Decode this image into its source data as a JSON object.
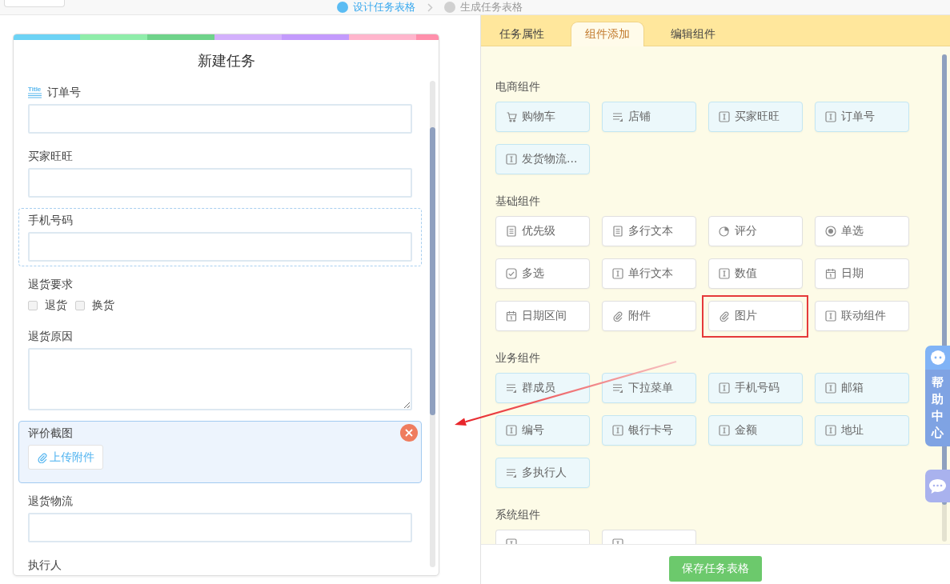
{
  "top_bar": {
    "steps": [
      {
        "label": "设计任务表格",
        "active": true
      },
      {
        "label": "生成任务表格",
        "active": false
      }
    ]
  },
  "form": {
    "title": "新建任务",
    "fields": [
      {
        "label": "订单号",
        "badge": "Title",
        "kind": "input",
        "hovered": false,
        "selected": false
      },
      {
        "label": "买家旺旺",
        "kind": "input",
        "hovered": false,
        "selected": false
      },
      {
        "label": "手机号码",
        "kind": "input",
        "hovered": true,
        "selected": false
      },
      {
        "label": "退货要求",
        "kind": "checkboxes",
        "hovered": false,
        "selected": false,
        "options": [
          {
            "label": "退货",
            "checked": false
          },
          {
            "label": "换货",
            "checked": false
          }
        ]
      },
      {
        "label": "退货原因",
        "kind": "textarea",
        "hovered": false,
        "selected": false
      },
      {
        "label": "评价截图",
        "kind": "upload",
        "button": "上传附件",
        "hovered": false,
        "selected": true
      },
      {
        "label": "退货物流",
        "kind": "input",
        "hovered": false,
        "selected": false
      },
      {
        "label": "执行人",
        "kind": "label",
        "hovered": false,
        "selected": false
      }
    ]
  },
  "panel": {
    "tabs": [
      {
        "label": "任务属性",
        "selected": false
      },
      {
        "label": "组件添加",
        "selected": true
      },
      {
        "label": "编辑组件",
        "selected": false
      }
    ],
    "sections": [
      {
        "title": "电商组件",
        "tinted": true,
        "clipped": false,
        "items": [
          {
            "label": "购物车",
            "kind": "cart",
            "highlighted": false
          },
          {
            "label": "店铺",
            "kind": "list",
            "highlighted": false
          },
          {
            "label": "买家旺旺",
            "kind": "input",
            "highlighted": false
          },
          {
            "label": "订单号",
            "kind": "input",
            "highlighted": false
          },
          {
            "label": "发货物流...",
            "kind": "input",
            "highlighted": false
          }
        ]
      },
      {
        "title": "基础组件",
        "tinted": false,
        "clipped": false,
        "items": [
          {
            "label": "优先级",
            "kind": "doc",
            "highlighted": false
          },
          {
            "label": "多行文本",
            "kind": "doc",
            "highlighted": false
          },
          {
            "label": "评分",
            "kind": "pie",
            "highlighted": false
          },
          {
            "label": "单选",
            "kind": "radio",
            "highlighted": false
          },
          {
            "label": "多选",
            "kind": "checkbox",
            "highlighted": false
          },
          {
            "label": "单行文本",
            "kind": "input",
            "highlighted": false
          },
          {
            "label": "数值",
            "kind": "input",
            "highlighted": false
          },
          {
            "label": "日期",
            "kind": "date",
            "highlighted": false
          },
          {
            "label": "日期区间",
            "kind": "date",
            "highlighted": false
          },
          {
            "label": "附件",
            "kind": "clip",
            "highlighted": false
          },
          {
            "label": "图片",
            "kind": "clip",
            "highlighted": true
          },
          {
            "label": "联动组件",
            "kind": "input",
            "highlighted": false
          }
        ]
      },
      {
        "title": "业务组件",
        "tinted": true,
        "clipped": false,
        "items": [
          {
            "label": "群成员",
            "kind": "list",
            "highlighted": false
          },
          {
            "label": "下拉菜单",
            "kind": "list",
            "highlighted": false
          },
          {
            "label": "手机号码",
            "kind": "input",
            "highlighted": false
          },
          {
            "label": "邮箱",
            "kind": "input",
            "highlighted": false
          },
          {
            "label": "编号",
            "kind": "input",
            "highlighted": false
          },
          {
            "label": "银行卡号",
            "kind": "input",
            "highlighted": false
          },
          {
            "label": "金额",
            "kind": "input",
            "highlighted": false
          },
          {
            "label": "地址",
            "kind": "input",
            "highlighted": false
          },
          {
            "label": "多执行人",
            "kind": "list",
            "highlighted": false
          }
        ]
      },
      {
        "title": "系统组件",
        "tinted": false,
        "clipped": true,
        "items": [
          {
            "kind": "input"
          },
          {
            "kind": "input"
          }
        ]
      }
    ],
    "save_button": "保存任务表格"
  },
  "help_widget": {
    "label": "帮助中心"
  },
  "annotation_arrow": true
}
